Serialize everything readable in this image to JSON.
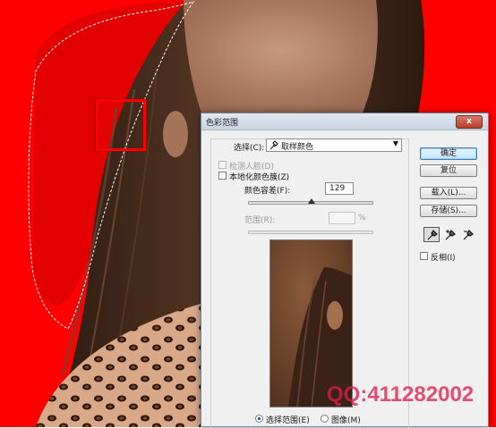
{
  "dialog": {
    "title": "色彩范围",
    "close_label": "x",
    "select": {
      "label": "选择(C):",
      "value": "取样颜色"
    },
    "detect_faces": {
      "label": "检测人脸(D)",
      "checked": false,
      "enabled": false
    },
    "localized_clusters": {
      "label": "本地化颜色簇(Z)",
      "checked": false
    },
    "fuzziness": {
      "label": "颜色容差(F):",
      "value": "129",
      "fraction": 0.51
    },
    "range": {
      "label": "范围(R):",
      "value": "",
      "unit": "%",
      "enabled": false
    },
    "view": {
      "selection": {
        "label": "选择范围(E)",
        "checked": true
      },
      "image": {
        "label": "图像(M)",
        "checked": false
      }
    },
    "buttons": {
      "ok": "确定",
      "reset": "复位",
      "load": "载入(L)...",
      "save": "存储(S)..."
    },
    "invert": {
      "label": "反相(I)",
      "checked": false
    },
    "tools": [
      "eyedropper-icon",
      "eyedropper-plus-icon",
      "eyedropper-minus-icon"
    ]
  },
  "watermark": "QQ:411282002",
  "colors": {
    "mask_red": "#ff0000",
    "hair_brown": "#4a2e1f",
    "skin": "#b98a6e",
    "dialog_bg": "#f0f0f0",
    "default_button": "#3c7fb1"
  }
}
